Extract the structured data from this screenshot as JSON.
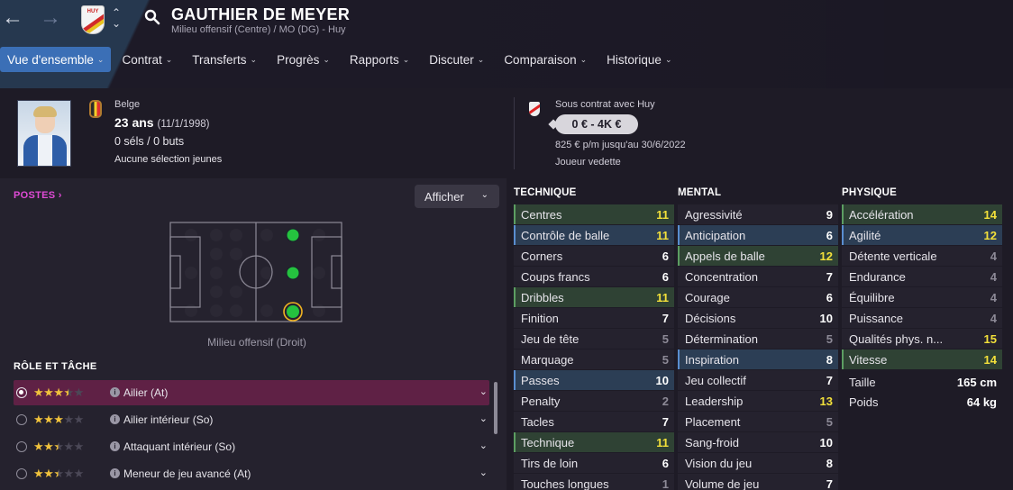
{
  "header": {
    "player_name": "GAUTHIER DE MEYER",
    "subtitle": "Milieu offensif (Centre) / MO (DG) - Huy",
    "club_crest_text": "HUY"
  },
  "tabs": [
    {
      "label": "Vue d'ensemble",
      "active": true
    },
    {
      "label": "Contrat"
    },
    {
      "label": "Transferts"
    },
    {
      "label": "Progrès"
    },
    {
      "label": "Rapports"
    },
    {
      "label": "Discuter"
    },
    {
      "label": "Comparaison"
    },
    {
      "label": "Historique"
    }
  ],
  "profile": {
    "nationality": "Belge",
    "age": "23 ans",
    "birthdate": "(11/1/1998)",
    "caps": "0 séls / 0 buts",
    "youth": "Aucune sélection jeunes"
  },
  "contract": {
    "label": "Sous contrat avec Huy",
    "value": "0 € - 4K €",
    "wage": "825 € p/m jusqu'au 30/6/2022",
    "status": "Joueur vedette"
  },
  "positions": {
    "title": "POSTES",
    "show_button": "Afficher",
    "caption": "Milieu offensif (Droit)"
  },
  "roles": {
    "title": "RÔLE ET TÂCHE",
    "items": [
      {
        "name": "Ailier (At)",
        "stars": 3.5,
        "selected": true
      },
      {
        "name": "Ailier intérieur (So)",
        "stars": 3
      },
      {
        "name": "Attaquant intérieur (So)",
        "stars": 2.5
      },
      {
        "name": "Meneur de jeu avancé (At)",
        "stars": 2.5
      }
    ]
  },
  "technique": {
    "title": "TECHNIQUE",
    "rows": [
      {
        "label": "Centres",
        "value": "11",
        "hl": "green"
      },
      {
        "label": "Contrôle de balle",
        "value": "11",
        "hl": "blue"
      },
      {
        "label": "Corners",
        "value": "6"
      },
      {
        "label": "Coups francs",
        "value": "6"
      },
      {
        "label": "Dribbles",
        "value": "11",
        "hl": "green"
      },
      {
        "label": "Finition",
        "value": "7"
      },
      {
        "label": "Jeu de tête",
        "value": "5"
      },
      {
        "label": "Marquage",
        "value": "5"
      },
      {
        "label": "Passes",
        "value": "10",
        "hl": "blue"
      },
      {
        "label": "Penalty",
        "value": "2"
      },
      {
        "label": "Tacles",
        "value": "7"
      },
      {
        "label": "Technique",
        "value": "11",
        "hl": "green"
      },
      {
        "label": "Tirs de loin",
        "value": "6"
      },
      {
        "label": "Touches longues",
        "value": "1"
      }
    ]
  },
  "mental": {
    "title": "MENTAL",
    "rows": [
      {
        "label": "Agressivité",
        "value": "9"
      },
      {
        "label": "Anticipation",
        "value": "6",
        "hl": "blue"
      },
      {
        "label": "Appels de balle",
        "value": "12",
        "hl": "green"
      },
      {
        "label": "Concentration",
        "value": "7"
      },
      {
        "label": "Courage",
        "value": "6"
      },
      {
        "label": "Décisions",
        "value": "10"
      },
      {
        "label": "Détermination",
        "value": "5"
      },
      {
        "label": "Inspiration",
        "value": "8",
        "hl": "blue"
      },
      {
        "label": "Jeu collectif",
        "value": "7"
      },
      {
        "label": "Leadership",
        "value": "13"
      },
      {
        "label": "Placement",
        "value": "5"
      },
      {
        "label": "Sang-froid",
        "value": "10"
      },
      {
        "label": "Vision du jeu",
        "value": "8"
      },
      {
        "label": "Volume de jeu",
        "value": "7"
      }
    ]
  },
  "physique": {
    "title": "PHYSIQUE",
    "rows": [
      {
        "label": "Accélération",
        "value": "14",
        "hl": "green"
      },
      {
        "label": "Agilité",
        "value": "12",
        "hl": "blue"
      },
      {
        "label": "Détente verticale",
        "value": "4"
      },
      {
        "label": "Endurance",
        "value": "4"
      },
      {
        "label": "Équilibre",
        "value": "4"
      },
      {
        "label": "Puissance",
        "value": "4"
      },
      {
        "label": "Qualités phys. n...",
        "value": "15"
      },
      {
        "label": "Vitesse",
        "value": "14",
        "hl": "green"
      }
    ],
    "height_label": "Taille",
    "height_value": "165 cm",
    "weight_label": "Poids",
    "weight_value": "64 kg"
  }
}
